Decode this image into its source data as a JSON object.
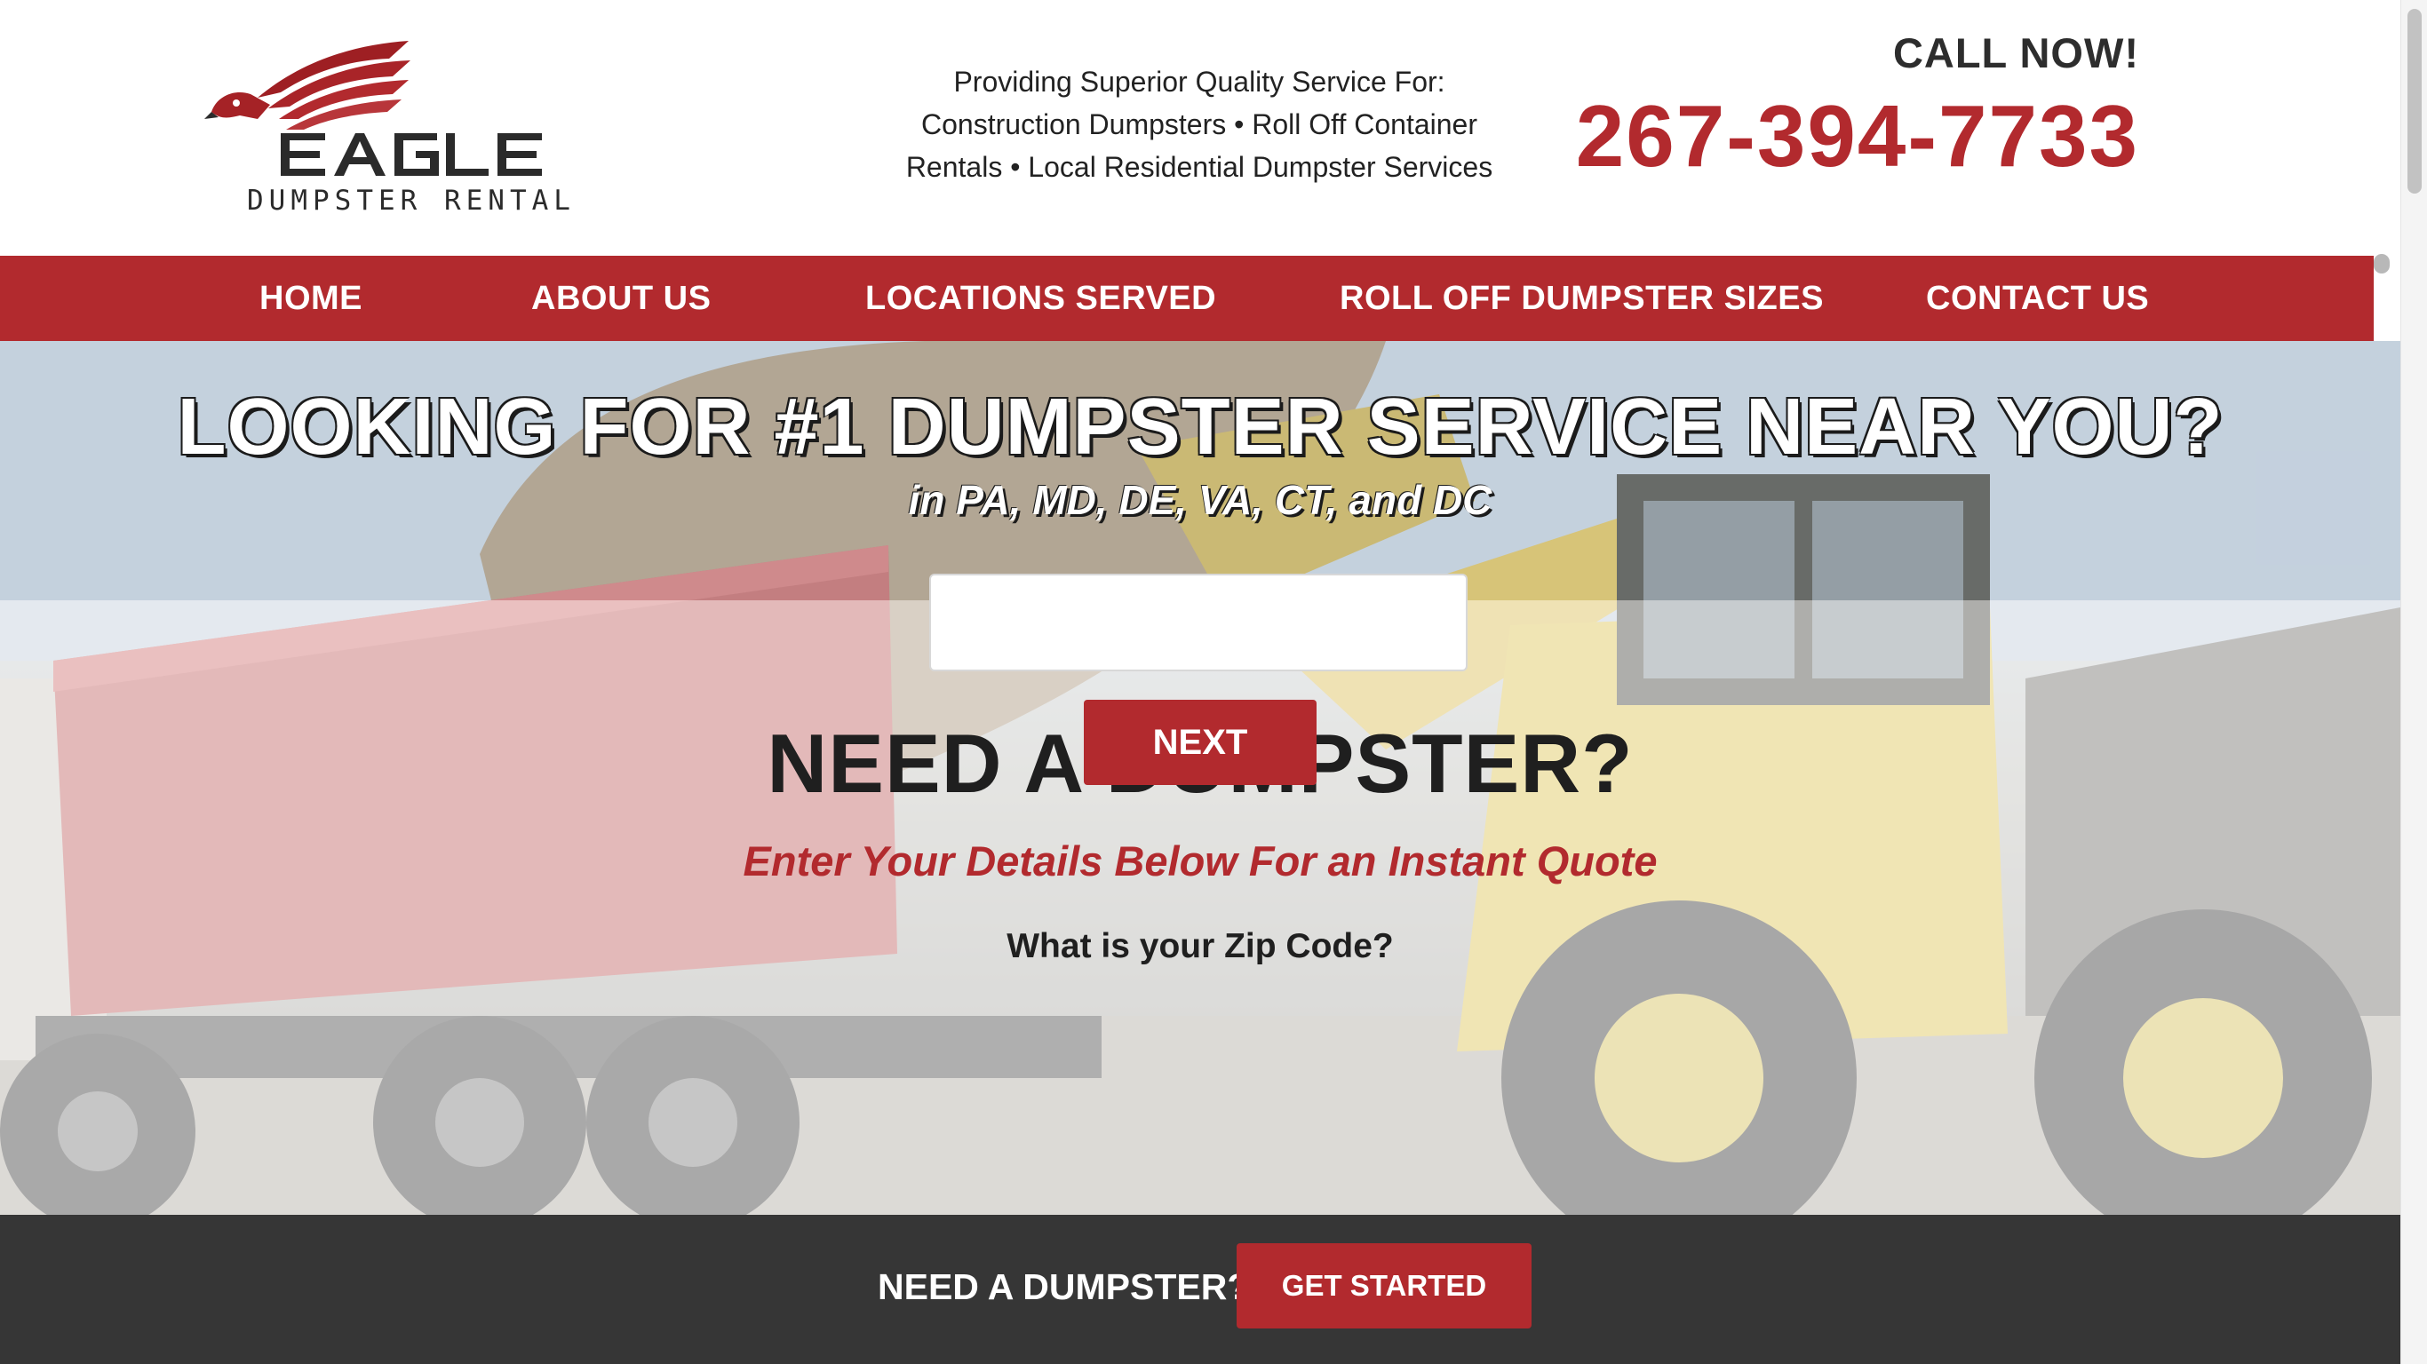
{
  "brand": {
    "logo_text": "EAGLE",
    "logo_subtext": "DUMPSTER RENTAL",
    "accent_color": "#b22a2e",
    "dark_color": "#363636"
  },
  "header": {
    "tagline_line1": "Providing Superior Quality Service For:",
    "tagline_line2": "Construction Dumpsters • Roll Off Container",
    "tagline_line3": "Rentals • Local Residential Dumpster Services",
    "call_label": "CALL NOW!",
    "phone": "267-394-7733"
  },
  "nav": {
    "items": [
      {
        "label": "HOME"
      },
      {
        "label": "ABOUT US"
      },
      {
        "label": "LOCATIONS SERVED"
      },
      {
        "label": "ROLL OFF DUMPSTER SIZES"
      },
      {
        "label": "CONTACT US"
      }
    ]
  },
  "hero": {
    "title": "LOOKING FOR #1 DUMPSTER SERVICE NEAR YOU?",
    "subtitle": "in PA, MD, DE, VA, CT, and DC",
    "background_image": "dump-truck-and-wheel-loader-photo"
  },
  "quote_form": {
    "title": "NEED A DUMPSTER?",
    "subtitle": "Enter Your Details Below For an Instant Quote",
    "zip_label": "What is your Zip Code?",
    "zip_value": "",
    "zip_placeholder": "",
    "next_label": "NEXT"
  },
  "bottom_bar": {
    "text": "NEED A DUMPSTER?",
    "button_label": "GET STARTED"
  }
}
